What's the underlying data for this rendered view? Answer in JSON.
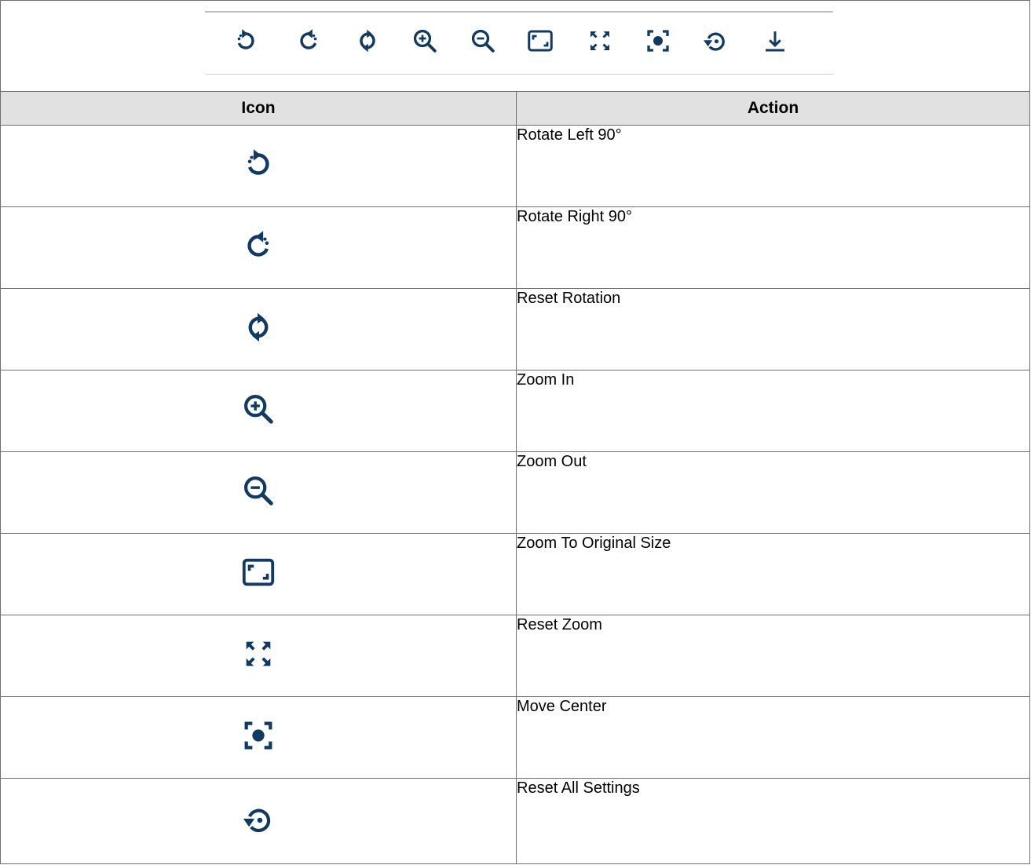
{
  "toolbar": {
    "buttons": [
      {
        "icon": "rotate-left-icon"
      },
      {
        "icon": "rotate-right-icon"
      },
      {
        "icon": "reset-rotation-icon"
      },
      {
        "icon": "zoom-in-icon"
      },
      {
        "icon": "zoom-out-icon"
      },
      {
        "icon": "original-size-icon"
      },
      {
        "icon": "reset-zoom-icon"
      },
      {
        "icon": "move-center-icon"
      },
      {
        "icon": "reset-all-icon"
      },
      {
        "icon": "download-icon"
      }
    ]
  },
  "table": {
    "headers": {
      "icon": "Icon",
      "action": "Action"
    },
    "rows": [
      {
        "icon": "rotate-left-icon",
        "action": "Rotate Left 90°"
      },
      {
        "icon": "rotate-right-icon",
        "action": "Rotate Right 90°"
      },
      {
        "icon": "reset-rotation-icon",
        "action": "Reset Rotation"
      },
      {
        "icon": "zoom-in-icon",
        "action": "Zoom In"
      },
      {
        "icon": "zoom-out-icon",
        "action": "Zoom Out"
      },
      {
        "icon": "original-size-icon",
        "action": "Zoom To Original Size"
      },
      {
        "icon": "reset-zoom-icon",
        "action": "Reset Zoom"
      },
      {
        "icon": "move-center-icon",
        "action": "Move Center"
      },
      {
        "icon": "reset-all-icon",
        "action": "Reset All Settings"
      }
    ]
  },
  "colors": {
    "icon": "#0e3a63",
    "header_bg": "#e1e1e1",
    "border": "#6f6f6f"
  }
}
